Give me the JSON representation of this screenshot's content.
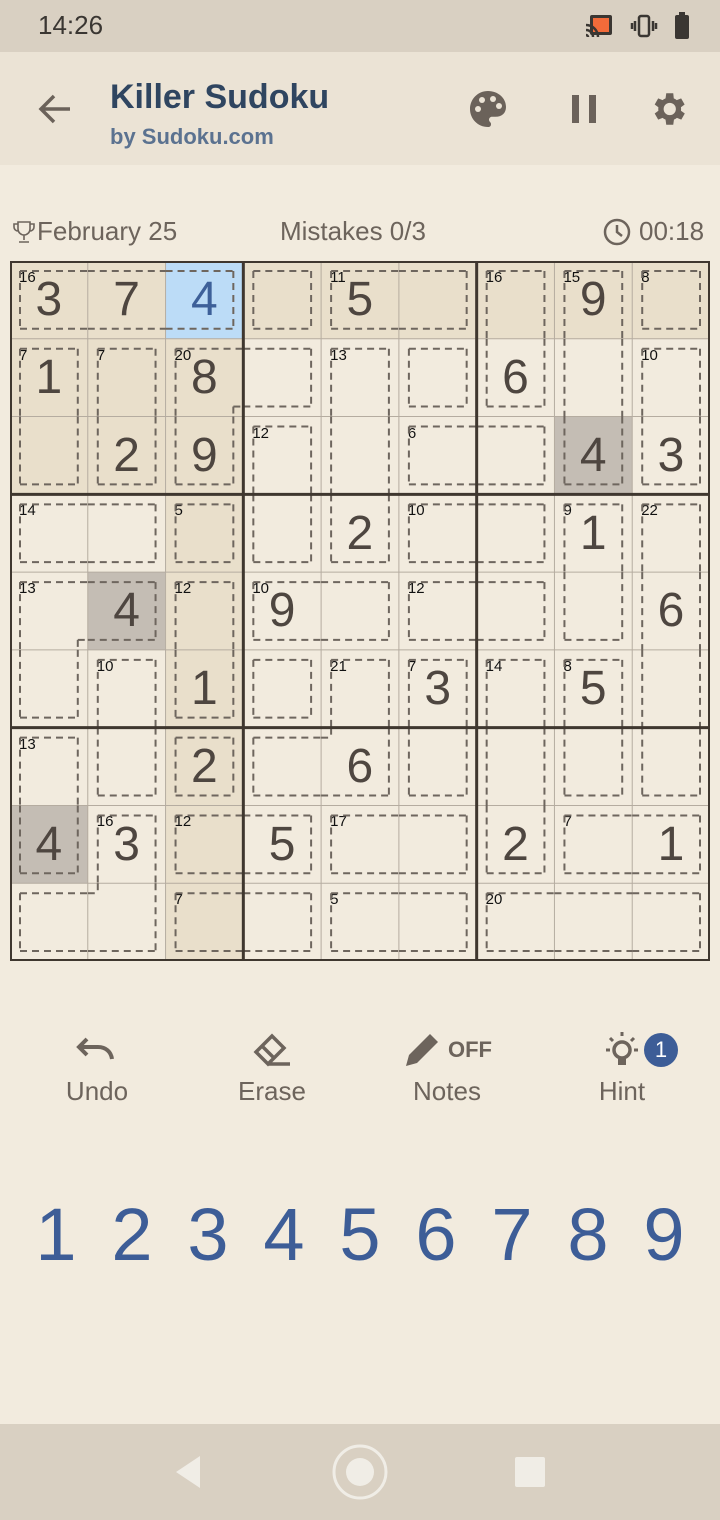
{
  "status_bar": {
    "time": "14:26",
    "icons": [
      "cast-icon",
      "vibrate-icon",
      "battery-icon"
    ]
  },
  "app_bar": {
    "title": "Killer Sudoku",
    "subtitle": "by Sudoku.com",
    "icons": [
      "back-arrow-icon",
      "palette-icon",
      "pause-icon",
      "gear-icon"
    ]
  },
  "info": {
    "date": "February 25",
    "mistakes": "Mistakes 0/3",
    "timer": "00:18"
  },
  "grid": {
    "values": [
      [
        3,
        7,
        4,
        0,
        5,
        0,
        0,
        9,
        0
      ],
      [
        1,
        0,
        8,
        0,
        0,
        0,
        6,
        0,
        0
      ],
      [
        0,
        2,
        9,
        0,
        0,
        0,
        0,
        4,
        3
      ],
      [
        0,
        0,
        0,
        0,
        2,
        0,
        0,
        1,
        0
      ],
      [
        0,
        4,
        0,
        9,
        0,
        0,
        0,
        0,
        6
      ],
      [
        0,
        0,
        1,
        0,
        0,
        3,
        0,
        5,
        0
      ],
      [
        0,
        0,
        2,
        0,
        6,
        0,
        0,
        0,
        0
      ],
      [
        4,
        3,
        0,
        5,
        0,
        0,
        2,
        0,
        1
      ],
      [
        0,
        0,
        0,
        0,
        0,
        0,
        0,
        0,
        0
      ]
    ],
    "selected": [
      0,
      2
    ],
    "cages": [
      {
        "sum": 16,
        "cells": [
          [
            0,
            0
          ],
          [
            0,
            1
          ],
          [
            0,
            2
          ]
        ]
      },
      {
        "sum": "",
        "cells": [
          [
            0,
            3
          ]
        ]
      },
      {
        "sum": 11,
        "cells": [
          [
            0,
            4
          ],
          [
            0,
            5
          ]
        ]
      },
      {
        "sum": 16,
        "cells": [
          [
            0,
            6
          ],
          [
            1,
            6
          ]
        ]
      },
      {
        "sum": 15,
        "cells": [
          [
            0,
            7
          ],
          [
            1,
            7
          ],
          [
            2,
            7
          ]
        ]
      },
      {
        "sum": 8,
        "cells": [
          [
            0,
            8
          ]
        ]
      },
      {
        "sum": 7,
        "cells": [
          [
            1,
            0
          ],
          [
            2,
            0
          ]
        ]
      },
      {
        "sum": 7,
        "cells": [
          [
            1,
            1
          ],
          [
            2,
            1
          ]
        ]
      },
      {
        "sum": 20,
        "cells": [
          [
            1,
            2
          ],
          [
            2,
            2
          ],
          [
            1,
            3
          ]
        ]
      },
      {
        "sum": 13,
        "cells": [
          [
            1,
            4
          ],
          [
            2,
            4
          ],
          [
            3,
            4
          ]
        ]
      },
      {
        "sum": "",
        "cells": [
          [
            1,
            5
          ]
        ]
      },
      {
        "sum": 10,
        "cells": [
          [
            1,
            8
          ],
          [
            2,
            8
          ]
        ]
      },
      {
        "sum": 12,
        "cells": [
          [
            2,
            3
          ],
          [
            3,
            3
          ]
        ]
      },
      {
        "sum": 6,
        "cells": [
          [
            2,
            5
          ],
          [
            2,
            6
          ]
        ]
      },
      {
        "sum": 14,
        "cells": [
          [
            3,
            0
          ],
          [
            3,
            1
          ]
        ]
      },
      {
        "sum": 5,
        "cells": [
          [
            3,
            2
          ]
        ]
      },
      {
        "sum": 10,
        "cells": [
          [
            3,
            5
          ],
          [
            3,
            6
          ]
        ]
      },
      {
        "sum": 9,
        "cells": [
          [
            3,
            7
          ],
          [
            4,
            7
          ]
        ]
      },
      {
        "sum": 22,
        "cells": [
          [
            3,
            8
          ],
          [
            4,
            8
          ],
          [
            5,
            8
          ],
          [
            6,
            8
          ]
        ]
      },
      {
        "sum": 13,
        "cells": [
          [
            4,
            0
          ],
          [
            4,
            1
          ],
          [
            5,
            0
          ]
        ]
      },
      {
        "sum": 12,
        "cells": [
          [
            4,
            2
          ],
          [
            5,
            2
          ]
        ]
      },
      {
        "sum": 10,
        "cells": [
          [
            4,
            3
          ],
          [
            4,
            4
          ]
        ]
      },
      {
        "sum": 12,
        "cells": [
          [
            4,
            5
          ],
          [
            4,
            6
          ]
        ]
      },
      {
        "sum": 10,
        "cells": [
          [
            5,
            1
          ],
          [
            6,
            1
          ]
        ]
      },
      {
        "sum": "",
        "cells": [
          [
            5,
            3
          ]
        ]
      },
      {
        "sum": 21,
        "cells": [
          [
            5,
            4
          ],
          [
            6,
            3
          ],
          [
            6,
            4
          ]
        ]
      },
      {
        "sum": 7,
        "cells": [
          [
            5,
            5
          ],
          [
            6,
            5
          ]
        ]
      },
      {
        "sum": 14,
        "cells": [
          [
            5,
            6
          ],
          [
            6,
            6
          ],
          [
            7,
            6
          ]
        ]
      },
      {
        "sum": 8,
        "cells": [
          [
            5,
            7
          ],
          [
            6,
            7
          ]
        ]
      },
      {
        "sum": 13,
        "cells": [
          [
            6,
            0
          ],
          [
            7,
            0
          ]
        ]
      },
      {
        "sum": "",
        "cells": [
          [
            6,
            2
          ]
        ]
      },
      {
        "sum": 16,
        "cells": [
          [
            7,
            1
          ],
          [
            8,
            0
          ],
          [
            8,
            1
          ]
        ]
      },
      {
        "sum": 12,
        "cells": [
          [
            7,
            2
          ],
          [
            7,
            3
          ]
        ]
      },
      {
        "sum": 17,
        "cells": [
          [
            7,
            4
          ],
          [
            7,
            5
          ]
        ]
      },
      {
        "sum": 7,
        "cells": [
          [
            7,
            7
          ],
          [
            7,
            8
          ]
        ]
      },
      {
        "sum": 7,
        "cells": [
          [
            8,
            2
          ],
          [
            8,
            3
          ]
        ]
      },
      {
        "sum": 5,
        "cells": [
          [
            8,
            4
          ],
          [
            8,
            5
          ]
        ]
      },
      {
        "sum": 20,
        "cells": [
          [
            8,
            6
          ],
          [
            8,
            7
          ],
          [
            8,
            8
          ]
        ]
      }
    ]
  },
  "tools": [
    {
      "label": "Undo",
      "icon": "undo-icon"
    },
    {
      "label": "Erase",
      "icon": "eraser-icon"
    },
    {
      "label": "Notes",
      "icon": "pencil-icon",
      "state": "OFF"
    },
    {
      "label": "Hint",
      "icon": "lightbulb-icon",
      "badge": "1"
    }
  ],
  "numpad": [
    "1",
    "2",
    "3",
    "4",
    "5",
    "6",
    "7",
    "8",
    "9"
  ],
  "colors": {
    "accent": "#3d5d97",
    "title": "#2f4560",
    "selected": "#bcdcf7",
    "highlight": "#e9dfcb",
    "same_value": "#c4bdb4"
  }
}
